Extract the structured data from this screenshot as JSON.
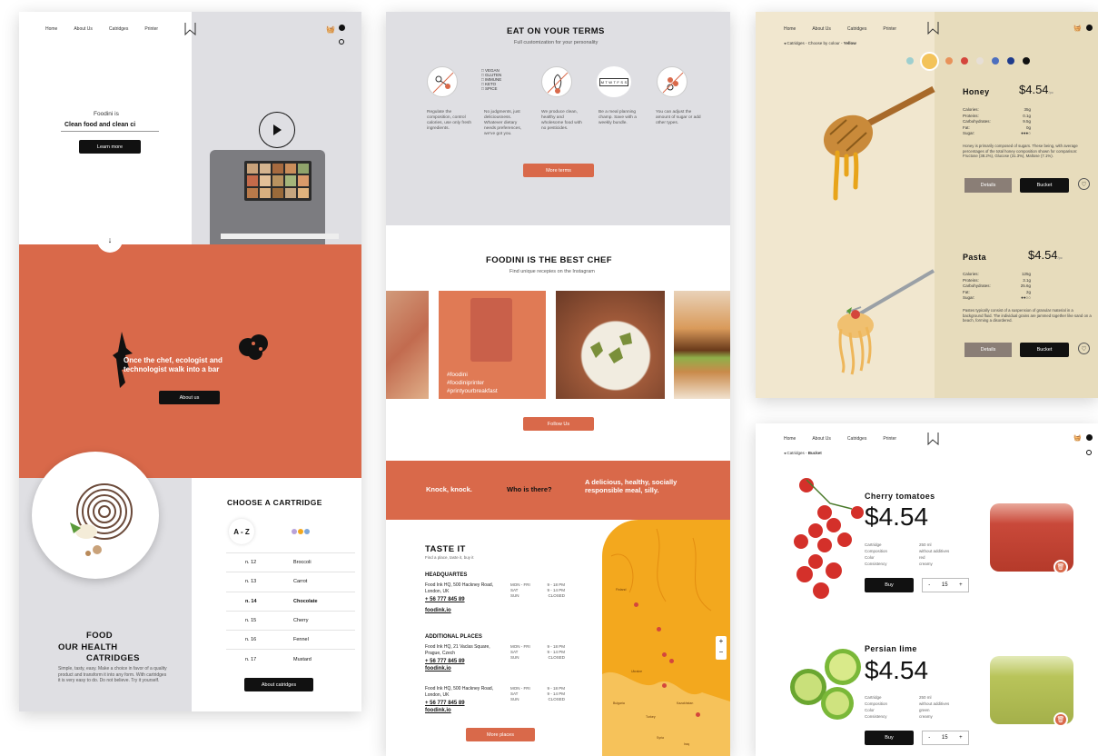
{
  "nav": {
    "home": "Home",
    "about": "About Us",
    "catridges": "Catridges",
    "printer": "Printer"
  },
  "panel1": {
    "hero_kicker": "Foodini is",
    "hero_headline": "Clean food and clean ci",
    "learn_more": "Learn more",
    "tagline": "Once the chef, ecologist and technologist walk into a bar",
    "about_us": "About us",
    "choose_title": "CHOOSE A CARTRIDGE",
    "az": "A - Z",
    "cartridges": [
      {
        "n": "n. 12",
        "name": "Broccoli"
      },
      {
        "n": "n. 13",
        "name": "Carrot"
      },
      {
        "n": "n. 14",
        "name": "Chocolate"
      },
      {
        "n": "n. 15",
        "name": "Cherry"
      },
      {
        "n": "n. 16",
        "name": "Fennel"
      },
      {
        "n": "n. 17",
        "name": "Mustard"
      }
    ],
    "food_line1": "FOOD",
    "food_line2": "OUR HEALTH",
    "food_line3": "CATRIDGES",
    "food_desc": "Simple, tasty, easy. Make a choice in favor of a quality product and transform it into any form. With cartridges it is very easy to do. Do not believe. Try it yourself.",
    "about_cartridges": "About catridges"
  },
  "panel2": {
    "eat_title": "EAT ON YOUR TERMS",
    "eat_sub": "Full customization for your personality",
    "diet_options": [
      "VEGAN",
      "GLUTEN",
      "IMMUNE",
      "KETO",
      "SPICE"
    ],
    "week": "M T W T F S S",
    "features": [
      "Regulate the composition, control calories, use only fresh ingredients.",
      "No judgments, just deliciousness. Whatever dietary needs preferences, we've got you.",
      "We produce clean, healthy and wholesome food with no pesticides.",
      "Be a meal planning champ. Save with a weekly bundle.",
      "You can adjust the amount of sugar or add other types."
    ],
    "more_terms": "More terms",
    "best_title": "FOODINI IS THE BEST CHEF",
    "best_sub": "Find unique recepies on the Instagram",
    "hashtags": [
      "#foodini",
      "#foodiniprinter",
      "#printyourbreakfast"
    ],
    "follow_us": "Follow Us",
    "knock": "Knock, knock.",
    "who": "Who is there?",
    "answer": "A delicious, healthy, socially responsible meal, silly.",
    "taste_title": "TASTE IT",
    "taste_sub": "Find a place, taste it, buy it",
    "hq_title": "HEADQUARTES",
    "hq_address": "Food Ink HQ, 500 Hackney Road, London, UK",
    "phone": "+ 56 777 845 89",
    "site": "foodink.io",
    "hours": [
      {
        "d": "MON - FRI",
        "h": "9 - 18 PM"
      },
      {
        "d": "SAT",
        "h": "9 - 14 PM"
      },
      {
        "d": "SUN",
        "h": "CLOSED"
      }
    ],
    "additional_title": "ADDITIONAL PLACES",
    "place2_address": "Food Ink HQ, 21 Vaclas Square, Prague, Czech",
    "place3_address": "Food Ink HQ, 500 Hackney Road, London, UK",
    "more_places": "More places",
    "map_plus": "+",
    "map_minus": "−",
    "map_labels": [
      "Finland",
      "Ukraine",
      "Bulgaria",
      "Turkey",
      "Kazakhstan",
      "Syria",
      "Iraq"
    ]
  },
  "panel3": {
    "breadcrumb": "Catridges - Choose by colour - ",
    "breadcrumb_current": "Yellow",
    "swatches": [
      "#9ecfcf",
      "#f3c35a",
      "#e8925a",
      "#d4463c",
      "#e7dfd6",
      "#4d6fbf",
      "#1f3b8c",
      "#111111"
    ],
    "products": [
      {
        "name": "Honey",
        "price": "$4.54",
        "unit": "/pc",
        "nutrition": [
          [
            "Calories:",
            "35g"
          ],
          [
            "Proteins:",
            "0.1g"
          ],
          [
            "Carbohydrates:",
            "9.5g"
          ],
          [
            "Fat:",
            "0g"
          ],
          [
            "Sugar:",
            ""
          ]
        ],
        "desc": "Honey is primarily composed of sugars. These being, with average percentages of the total honey composition shown for comparison: Fructose (38.2%), Glucose (31.3%), Maltose (7.1%).",
        "details": "Details",
        "bucket": "Bucket"
      },
      {
        "name": "Pasta",
        "price": "$4.54",
        "unit": "/pc",
        "nutrition": [
          [
            "Calories:",
            "125g"
          ],
          [
            "Proteins:",
            "3.1g"
          ],
          [
            "Carbohydrates:",
            "25.6g"
          ],
          [
            "Fat:",
            "2g"
          ],
          [
            "Sugar:",
            ""
          ]
        ],
        "desc": "Pastes typically consist of a suspension of granular material in a background fluid. The individual grains are jammed together like sand on a beach, forming a disordered.",
        "details": "Details",
        "bucket": "Bucket"
      }
    ]
  },
  "panel4": {
    "breadcrumb": "Catridges - ",
    "breadcrumb_current": "Bucket",
    "items": [
      {
        "name": "Cherry tomatoes",
        "price": "$4.54",
        "specs": [
          [
            "Cartridge",
            "250 ml"
          ],
          [
            "Composition",
            "without additives"
          ],
          [
            "Color",
            "red"
          ],
          [
            "Consistency",
            "creamy"
          ]
        ],
        "buy": "Buy",
        "qty": "15"
      },
      {
        "name": "Persian lime",
        "price": "$4.54",
        "specs": [
          [
            "Cartridge",
            "250 ml"
          ],
          [
            "Composition",
            "without additives"
          ],
          [
            "Color",
            "green"
          ],
          [
            "Consistency",
            "creamy"
          ]
        ],
        "buy": "Buy",
        "qty": "15"
      }
    ],
    "minus": "-",
    "plus": "+"
  },
  "colors": {
    "coral": "#d9694a",
    "grey": "#dfdfe3",
    "cream": "#f1e7cf",
    "cream_dark": "#e7dcbc",
    "map_orange": "#f3a81e"
  }
}
